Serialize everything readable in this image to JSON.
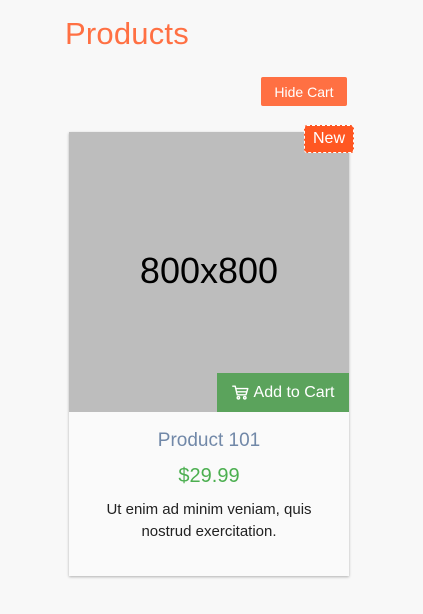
{
  "page": {
    "title": "Products"
  },
  "toolbar": {
    "hide_cart_label": "Hide Cart"
  },
  "product": {
    "badge": "New",
    "image_placeholder": "800x800",
    "add_to_cart_label": "Add to Cart",
    "add_to_cart_icon": "shopping-cart-icon",
    "name": "Product 101",
    "price": "$29.99",
    "description": "Ut enim ad minim veniam, quis nostrud exercitation."
  },
  "colors": {
    "accent": "#ff7043",
    "badge": "#ff5722",
    "add_to_cart": "#5ba35c",
    "price": "#4caf50",
    "product_name": "#7188a8",
    "image_placeholder": "#bdbdbd"
  }
}
